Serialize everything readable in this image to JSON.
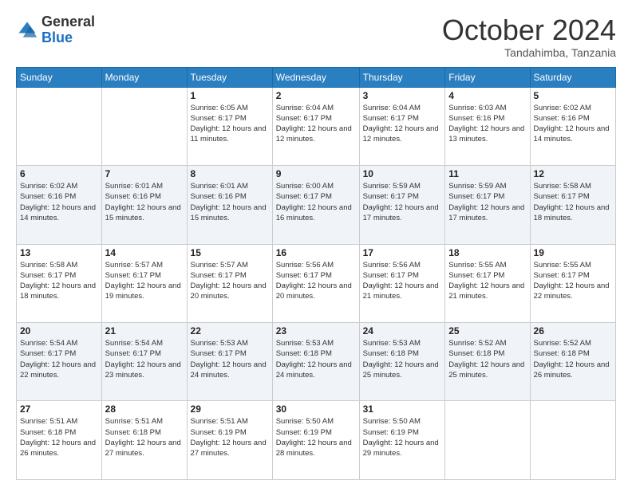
{
  "logo": {
    "general": "General",
    "blue": "Blue"
  },
  "header": {
    "month": "October 2024",
    "location": "Tandahimba, Tanzania"
  },
  "weekdays": [
    "Sunday",
    "Monday",
    "Tuesday",
    "Wednesday",
    "Thursday",
    "Friday",
    "Saturday"
  ],
  "weeks": [
    [
      {
        "day": "",
        "info": ""
      },
      {
        "day": "",
        "info": ""
      },
      {
        "day": "1",
        "info": "Sunrise: 6:05 AM\nSunset: 6:17 PM\nDaylight: 12 hours and 11 minutes."
      },
      {
        "day": "2",
        "info": "Sunrise: 6:04 AM\nSunset: 6:17 PM\nDaylight: 12 hours and 12 minutes."
      },
      {
        "day": "3",
        "info": "Sunrise: 6:04 AM\nSunset: 6:17 PM\nDaylight: 12 hours and 12 minutes."
      },
      {
        "day": "4",
        "info": "Sunrise: 6:03 AM\nSunset: 6:16 PM\nDaylight: 12 hours and 13 minutes."
      },
      {
        "day": "5",
        "info": "Sunrise: 6:02 AM\nSunset: 6:16 PM\nDaylight: 12 hours and 14 minutes."
      }
    ],
    [
      {
        "day": "6",
        "info": "Sunrise: 6:02 AM\nSunset: 6:16 PM\nDaylight: 12 hours and 14 minutes."
      },
      {
        "day": "7",
        "info": "Sunrise: 6:01 AM\nSunset: 6:16 PM\nDaylight: 12 hours and 15 minutes."
      },
      {
        "day": "8",
        "info": "Sunrise: 6:01 AM\nSunset: 6:16 PM\nDaylight: 12 hours and 15 minutes."
      },
      {
        "day": "9",
        "info": "Sunrise: 6:00 AM\nSunset: 6:17 PM\nDaylight: 12 hours and 16 minutes."
      },
      {
        "day": "10",
        "info": "Sunrise: 5:59 AM\nSunset: 6:17 PM\nDaylight: 12 hours and 17 minutes."
      },
      {
        "day": "11",
        "info": "Sunrise: 5:59 AM\nSunset: 6:17 PM\nDaylight: 12 hours and 17 minutes."
      },
      {
        "day": "12",
        "info": "Sunrise: 5:58 AM\nSunset: 6:17 PM\nDaylight: 12 hours and 18 minutes."
      }
    ],
    [
      {
        "day": "13",
        "info": "Sunrise: 5:58 AM\nSunset: 6:17 PM\nDaylight: 12 hours and 18 minutes."
      },
      {
        "day": "14",
        "info": "Sunrise: 5:57 AM\nSunset: 6:17 PM\nDaylight: 12 hours and 19 minutes."
      },
      {
        "day": "15",
        "info": "Sunrise: 5:57 AM\nSunset: 6:17 PM\nDaylight: 12 hours and 20 minutes."
      },
      {
        "day": "16",
        "info": "Sunrise: 5:56 AM\nSunset: 6:17 PM\nDaylight: 12 hours and 20 minutes."
      },
      {
        "day": "17",
        "info": "Sunrise: 5:56 AM\nSunset: 6:17 PM\nDaylight: 12 hours and 21 minutes."
      },
      {
        "day": "18",
        "info": "Sunrise: 5:55 AM\nSunset: 6:17 PM\nDaylight: 12 hours and 21 minutes."
      },
      {
        "day": "19",
        "info": "Sunrise: 5:55 AM\nSunset: 6:17 PM\nDaylight: 12 hours and 22 minutes."
      }
    ],
    [
      {
        "day": "20",
        "info": "Sunrise: 5:54 AM\nSunset: 6:17 PM\nDaylight: 12 hours and 22 minutes."
      },
      {
        "day": "21",
        "info": "Sunrise: 5:54 AM\nSunset: 6:17 PM\nDaylight: 12 hours and 23 minutes."
      },
      {
        "day": "22",
        "info": "Sunrise: 5:53 AM\nSunset: 6:17 PM\nDaylight: 12 hours and 24 minutes."
      },
      {
        "day": "23",
        "info": "Sunrise: 5:53 AM\nSunset: 6:18 PM\nDaylight: 12 hours and 24 minutes."
      },
      {
        "day": "24",
        "info": "Sunrise: 5:53 AM\nSunset: 6:18 PM\nDaylight: 12 hours and 25 minutes."
      },
      {
        "day": "25",
        "info": "Sunrise: 5:52 AM\nSunset: 6:18 PM\nDaylight: 12 hours and 25 minutes."
      },
      {
        "day": "26",
        "info": "Sunrise: 5:52 AM\nSunset: 6:18 PM\nDaylight: 12 hours and 26 minutes."
      }
    ],
    [
      {
        "day": "27",
        "info": "Sunrise: 5:51 AM\nSunset: 6:18 PM\nDaylight: 12 hours and 26 minutes."
      },
      {
        "day": "28",
        "info": "Sunrise: 5:51 AM\nSunset: 6:18 PM\nDaylight: 12 hours and 27 minutes."
      },
      {
        "day": "29",
        "info": "Sunrise: 5:51 AM\nSunset: 6:19 PM\nDaylight: 12 hours and 27 minutes."
      },
      {
        "day": "30",
        "info": "Sunrise: 5:50 AM\nSunset: 6:19 PM\nDaylight: 12 hours and 28 minutes."
      },
      {
        "day": "31",
        "info": "Sunrise: 5:50 AM\nSunset: 6:19 PM\nDaylight: 12 hours and 29 minutes."
      },
      {
        "day": "",
        "info": ""
      },
      {
        "day": "",
        "info": ""
      }
    ]
  ]
}
